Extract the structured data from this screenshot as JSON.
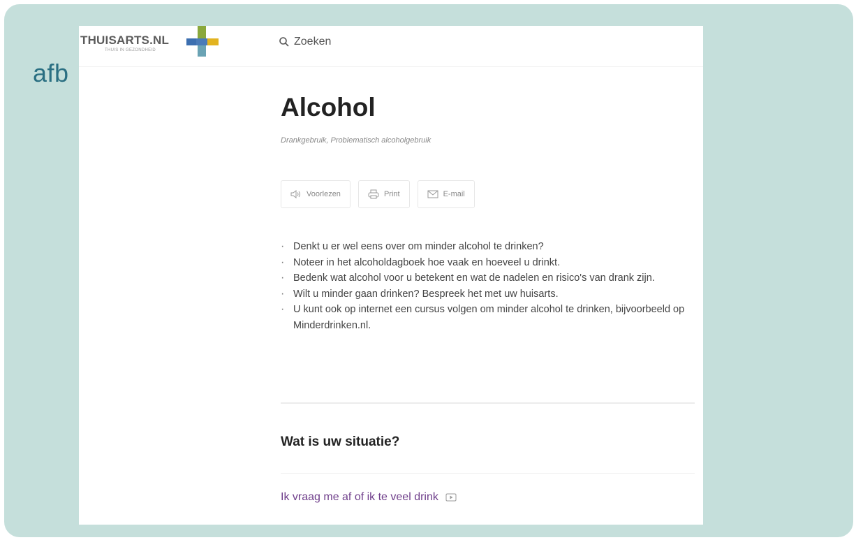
{
  "slide": {
    "label": "afb"
  },
  "site": {
    "logo_text": "THUISARTS.NL",
    "logo_tagline": "THUIS IN GEZONDHEID",
    "search_label": "Zoeken"
  },
  "article": {
    "title": "Alcohol",
    "subtitle": "Drankgebruik, Problematisch alcoholgebruik",
    "actions": [
      {
        "label": "Voorlezen",
        "icon": "speaker-icon"
      },
      {
        "label": "Print",
        "icon": "printer-icon"
      },
      {
        "label": "E-mail",
        "icon": "envelope-icon"
      }
    ],
    "bullets": [
      "Denkt u er wel eens over om minder alcohol te drinken?",
      "Noteer in het alcoholdagboek hoe vaak en hoeveel u drinkt.",
      "Bedenk wat alcohol voor u betekent en wat de nadelen en risico's van drank zijn.",
      "Wilt u minder gaan drinken? Bespreek het met uw huisarts.",
      "U kunt ook op internet een cursus volgen om minder alcohol te drinken, bijvoorbeeld op Minderdrinken.nl."
    ],
    "situation_heading": "Wat is uw situatie?",
    "situation_link": "Ik vraag me af of ik te veel drink"
  },
  "colors": {
    "slide_bg": "#c5dfdb",
    "slide_label": "#2a6f82",
    "link": "#6e3d8a",
    "logo_blue": "#3c6fb0",
    "logo_green": "#8aa83c",
    "logo_yellow": "#e2b320",
    "logo_teal": "#6aa3b4"
  }
}
